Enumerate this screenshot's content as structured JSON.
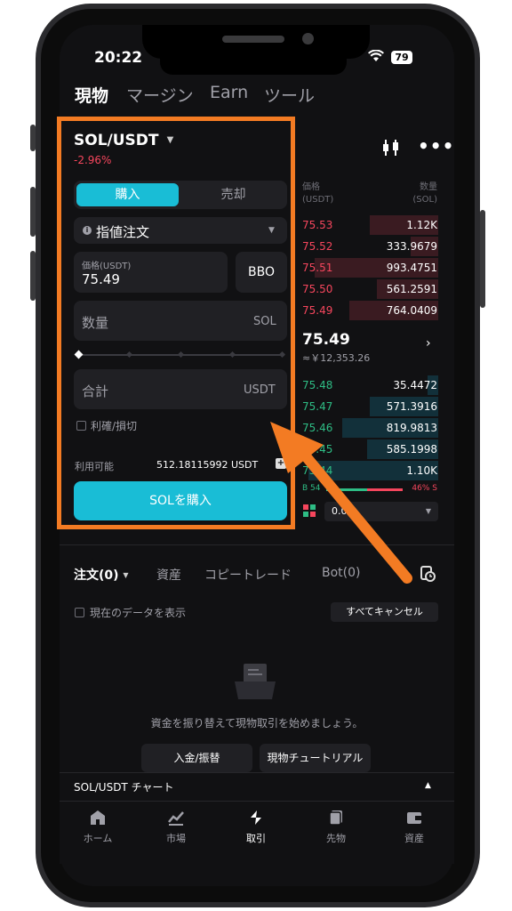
{
  "status": {
    "time": "20:22",
    "battery": "79"
  },
  "top_tabs": [
    "現物",
    "マージン",
    "Earn",
    "ツール"
  ],
  "pair": {
    "name": "SOL/USDT",
    "change": "-2.96%"
  },
  "order_form": {
    "buy_tab": "購入",
    "sell_tab": "売却",
    "order_type": "指値注文",
    "price_label": "価格(USDT)",
    "price_value": "75.49",
    "bbo_label": "BBO",
    "quantity_placeholder": "数量",
    "quantity_unit": "SOL",
    "total_placeholder": "合計",
    "total_unit": "USDT",
    "tpsl_label": "利確/損切",
    "available_label": "利用可能",
    "available_value": "512.18115992 USDT",
    "submit_label": "SOLを購入"
  },
  "orderbook": {
    "header_price": "価格",
    "header_price_unit": "(USDT)",
    "header_qty": "数量",
    "header_qty_unit": "(SOL)",
    "asks": [
      {
        "price": "75.53",
        "qty": "1.12K",
        "depth": 0.5
      },
      {
        "price": "75.52",
        "qty": "333.9679",
        "depth": 0.2
      },
      {
        "price": "75.51",
        "qty": "993.4751",
        "depth": 0.9
      },
      {
        "price": "75.50",
        "qty": "561.2591",
        "depth": 0.45
      },
      {
        "price": "75.49",
        "qty": "764.0409",
        "depth": 0.65
      }
    ],
    "last_price": "75.49",
    "last_price_fiat": "≈￥12,353.26",
    "bids": [
      {
        "price": "75.48",
        "qty": "35.4472",
        "depth": 0.08
      },
      {
        "price": "75.47",
        "qty": "571.3916",
        "depth": 0.5
      },
      {
        "price": "75.46",
        "qty": "819.9813",
        "depth": 0.7
      },
      {
        "price": "75.45",
        "qty": "585.1998",
        "depth": 0.52
      },
      {
        "price": "75.44",
        "qty": "1.10K",
        "depth": 0.95
      }
    ],
    "ratio_buy": "B 54",
    "ratio_sell": "46% S",
    "ratio_buy_fraction": 0.54,
    "precision_value": "0.0"
  },
  "orders_tabs": [
    "注文(0)",
    "資産",
    "コピートレード",
    "Bot(0)"
  ],
  "show_current_label": "現在のデータを表示",
  "cancel_all_label": "すべてキャンセル",
  "empty_message": "資金を振り替えて現物取引を始めましょう。",
  "empty_buttons": [
    "入金/振替",
    "現物チュートリアル"
  ],
  "chart_bar_label": "SOL/USDT チャート",
  "bottom_nav": [
    "ホーム",
    "市場",
    "取引",
    "先物",
    "資産"
  ],
  "colors": {
    "accent": "#19bdd6",
    "red": "#f6465d",
    "green": "#2ebd85",
    "highlight": "#f37b23"
  }
}
